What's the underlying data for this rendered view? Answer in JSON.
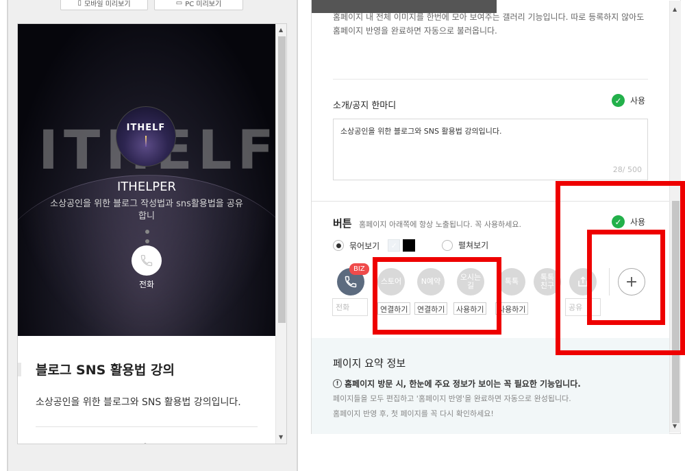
{
  "preview": {
    "top_buttons": [
      "모바일 미리보기",
      "PC 미리보기"
    ],
    "hero": {
      "bg_text": "ITHELF",
      "logo_text": "ITHELF",
      "title": "ITHELPER",
      "desc": "소상공인을 위한 블로그 작성법과 sns활용법을 공유합니",
      "call_label": "전화"
    },
    "blog_title": "블로그 SNS 활용법 강의",
    "blog_desc": "소상공인을 위한 블로그와 SNS 활용법 강의입니다."
  },
  "panel": {
    "gallery_desc_1": "홈페이지 내 전체 이미지를 한번에 모아 보여주는 갤러리 기능입니다. 따로 등록하지 않아도",
    "gallery_desc_2": "홈페이지 반영을 완료하면 자동으로 불러옵니다.",
    "intro": {
      "title": "소개/공지 한마디",
      "use_label": "사용",
      "text": "소상공인을 위한 블로그와 SNS 활용법 강의입니다.",
      "counter": "28/ 500"
    },
    "buttons": {
      "title": "버튼",
      "hint": "홈페이지 아래쪽에 항상 노출됩니다. 꼭 사용하세요.",
      "use_label": "사용",
      "radio_collapsed": "묶어보기",
      "radio_expanded": "펼쳐보기",
      "biz_badge": "BIZ",
      "items": [
        {
          "icon": "phone-icon",
          "label": "",
          "box": "전화"
        },
        {
          "icon": "store-icon",
          "label": "스토어",
          "action": "연결하기"
        },
        {
          "icon": "reservation-icon",
          "label": "N예약",
          "action": "연결하기"
        },
        {
          "icon": "directions-icon",
          "label": "오시는길",
          "action": "사용하기"
        },
        {
          "icon": "talktalk-icon",
          "label": "톡톡",
          "action": "사용하기"
        },
        {
          "icon": "talktalk-friend-icon",
          "label": "톡톡\n친구"
        },
        {
          "icon": "share-icon",
          "label": "",
          "box": "공유"
        }
      ],
      "add_symbol": "+"
    },
    "summary": {
      "title": "페이지 요약 정보",
      "bold": "홈페이지 방문 시, 한눈에 주요 정보가 보이는 꼭 필요한 기능입니다.",
      "line1": "페이지들을 모두 편집하고 '홈페이지 반영'을 완료하면 자동으로 완성됩니다.",
      "line2": "홈페이지 반영 후, 첫 페이지를 꼭 다시 확인하세요!"
    }
  },
  "colors": {
    "annotation_red": "#ee0000",
    "check_green": "#22b04a",
    "biz_red": "#ef4b4b",
    "phone_button_blue": "#5c6b7f"
  }
}
